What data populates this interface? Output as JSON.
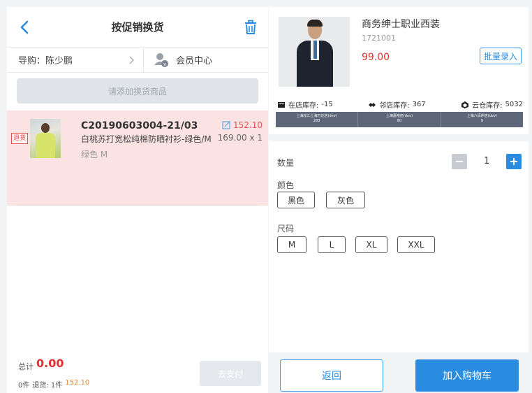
{
  "left": {
    "title": "按促销换货",
    "guide_label": "导购：陈少鹏",
    "member_label": "会员中心",
    "add_placeholder": "请添加换货商品",
    "item": {
      "return_badge": "退货",
      "code": "C20190603004-21/03",
      "name": "白桃苏打宽松纯棉防晒衬衫-绿色/M",
      "variant": "绿色 M",
      "price": "152.10",
      "qty": "169.00 x 1"
    },
    "footer": {
      "total_label": "总计",
      "total_value": "0.00",
      "count_text": "0件",
      "return_text": "退货: 1件",
      "return_amount": "152.10",
      "pay_label": "去支付"
    }
  },
  "right": {
    "product": {
      "name": "商务绅士职业西装",
      "code": "1721001",
      "price": "99.00"
    },
    "batch_label": "批量录入",
    "stock": {
      "store_label": "在店库存:",
      "store_value": "-15",
      "neighbor_label": "邻店库存:",
      "neighbor_value": "367",
      "cloud_label": "云仓库存:",
      "cloud_value": "5032"
    },
    "stores": [
      {
        "name": "上海松江上海万达店(dev)",
        "count": "283"
      },
      {
        "name": "上海嘉袍店(dev)",
        "count": "80"
      },
      {
        "name": "上海八佰伴店(dev)",
        "count": "9"
      }
    ],
    "quantity_label": "数量",
    "quantity_value": "1",
    "color_label": "颜色",
    "colors": [
      "黑色",
      "灰色"
    ],
    "size_label": "尺码",
    "sizes": [
      "M",
      "L",
      "XL",
      "XXL"
    ],
    "back_label": "返回",
    "cart_label": "加入购物车"
  },
  "colors": {
    "accent": "#2a8ce0",
    "price_red": "#e03030",
    "return_row_bg": "#fbe3e3",
    "store_bar_bg": "#5d6779"
  }
}
